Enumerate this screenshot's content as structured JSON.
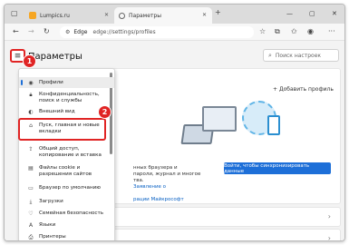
{
  "browser": {
    "tabs": [
      {
        "label": "Lumpics.ru"
      },
      {
        "label": "Параметры"
      }
    ],
    "new_tab": "+",
    "address": {
      "brand": "Edge",
      "url": "edge://settings/profiles"
    }
  },
  "settings": {
    "title": "Параметры",
    "search_placeholder": "Поиск настроек",
    "add_profile": "Добавить профиль",
    "sync_text": "нных браузера и\nпароли, журнал и многое\nтва.",
    "sync_link_1": "Заявление о",
    "sync_link_2": "рации Майкрософт",
    "sync_button": "Войти, чтобы синхронизировать данные"
  },
  "menu": {
    "items": [
      {
        "label": "Профили",
        "icon": "profile-icon"
      },
      {
        "label": "Конфиденциальность, поиск и службы",
        "icon": "lock-icon"
      },
      {
        "label": "Внешний вид",
        "icon": "appearance-icon"
      },
      {
        "label": "Пуск, главная и новые вкладки",
        "icon": "home-page-icon"
      },
      {
        "label": "Общий доступ, копирование и вставка",
        "icon": "share-icon"
      },
      {
        "label": "Файлы cookie и разрешения сайтов",
        "icon": "cookie-icon"
      },
      {
        "label": "Браузер по умолчанию",
        "icon": "browser-icon"
      },
      {
        "label": "Загрузки",
        "icon": "download-icon"
      },
      {
        "label": "Семейная безопасность",
        "icon": "family-icon"
      },
      {
        "label": "Языки",
        "icon": "language-icon"
      },
      {
        "label": "Принтеры",
        "icon": "printer-icon"
      }
    ]
  },
  "annotations": {
    "badge_1": "1",
    "badge_2": "2"
  },
  "colors": {
    "accent": "#1d6fd8",
    "annotation": "#e02424"
  }
}
